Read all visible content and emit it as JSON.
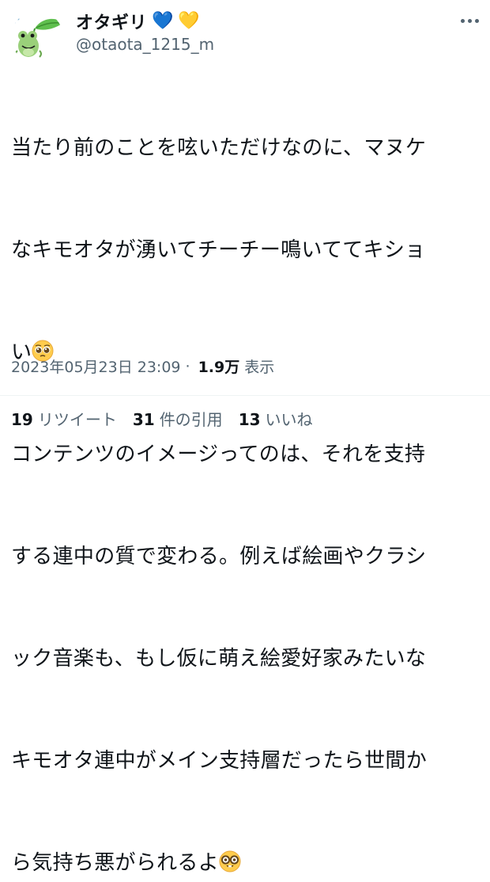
{
  "tweet": {
    "author": {
      "display_name": "オタギリ",
      "hearts": [
        "💙",
        "💛"
      ],
      "handle": "@otaota_1215_m",
      "avatar_icon": "frog-with-leaf-icon"
    },
    "text_lines": [
      "当たり前のことを呟いただけなのに、マヌケ",
      "なキモオタが湧いてチーチー鳴いててキショ",
      "い",
      "コンテンツのイメージってのは、それを支持",
      "する連中の質で変わる。例えば絵画やクラシ",
      "ック音楽も、もし仮に萌え絵愛好家みたいな",
      "キモオタ連中がメイン支持層だったら世間か",
      "ら気持ち悪がられるよ"
    ],
    "emojis": [
      "pleading-face-emoji",
      "nerd-face-emoji"
    ],
    "timestamp": "2023年05月23日 23:09",
    "separator": "·",
    "views_count": "1.9万",
    "views_label": "表示"
  },
  "stats": {
    "retweets": {
      "count": "19",
      "label": "リツイート"
    },
    "quotes": {
      "count": "31",
      "label": "件の引用"
    },
    "likes": {
      "count": "13",
      "label": "いいね"
    }
  }
}
